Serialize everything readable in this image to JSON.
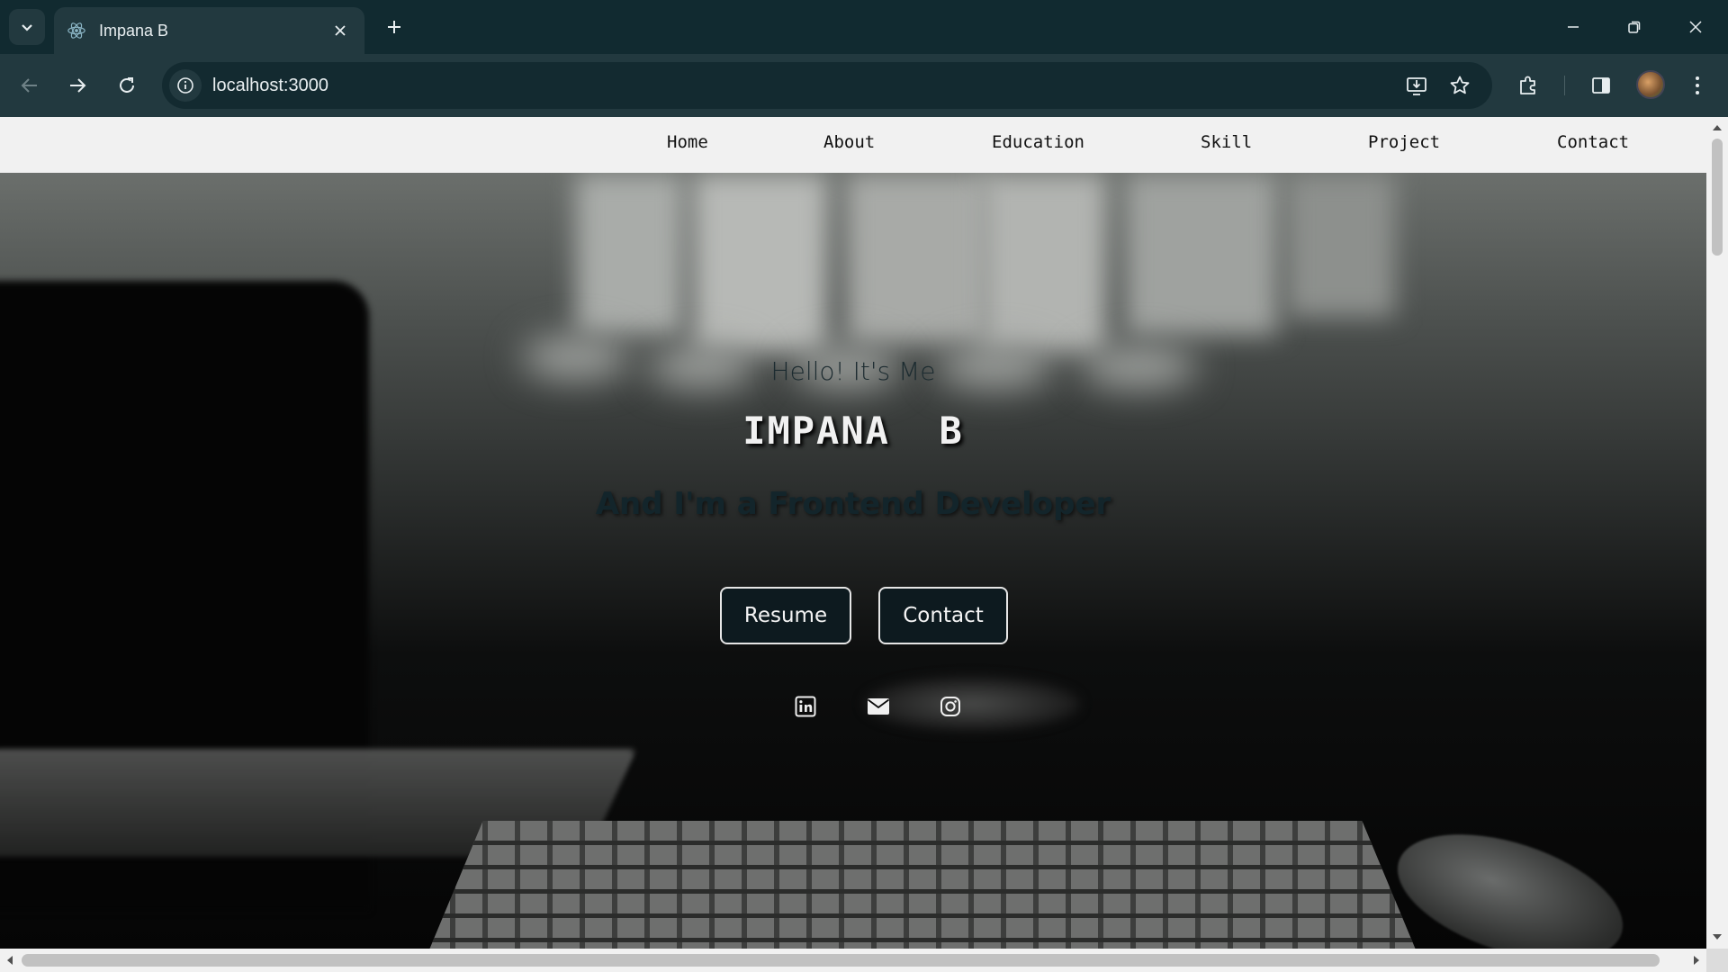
{
  "browser": {
    "tab_title": "Impana B",
    "url": "localhost:3000",
    "icons": {
      "tab_search": "chevron-down-icon",
      "favicon": "react-icon",
      "tab_close": "close-icon",
      "new_tab": "plus-icon",
      "minimize": "minimize-icon",
      "restore": "restore-icon",
      "close_window": "close-icon",
      "back": "back-arrow-icon",
      "forward": "forward-arrow-icon",
      "reload": "reload-icon",
      "site_info": "info-icon",
      "install": "install-app-icon",
      "bookmark": "star-icon",
      "extensions": "puzzle-icon",
      "side_panel": "side-panel-icon",
      "profile": "avatar",
      "menu": "kebab-menu-icon"
    }
  },
  "nav": {
    "links": [
      "Home",
      "About",
      "Education",
      "Skill",
      "Project",
      "Contact"
    ]
  },
  "hero": {
    "greeting": "Hello! It's Me",
    "name": "IMPANA  B",
    "role": "And I'm a Frontend Developer",
    "buttons": {
      "resume": "Resume",
      "contact": "Contact"
    },
    "social_icons": [
      "linkedin-icon",
      "mail-icon",
      "instagram-icon"
    ]
  },
  "colors": {
    "chrome_dark": "#112a30",
    "chrome_toolbar": "#22393f",
    "nav_bg": "#f1f1f1",
    "button_bg": "#0d1a1f",
    "button_border": "#e6e6e6"
  }
}
